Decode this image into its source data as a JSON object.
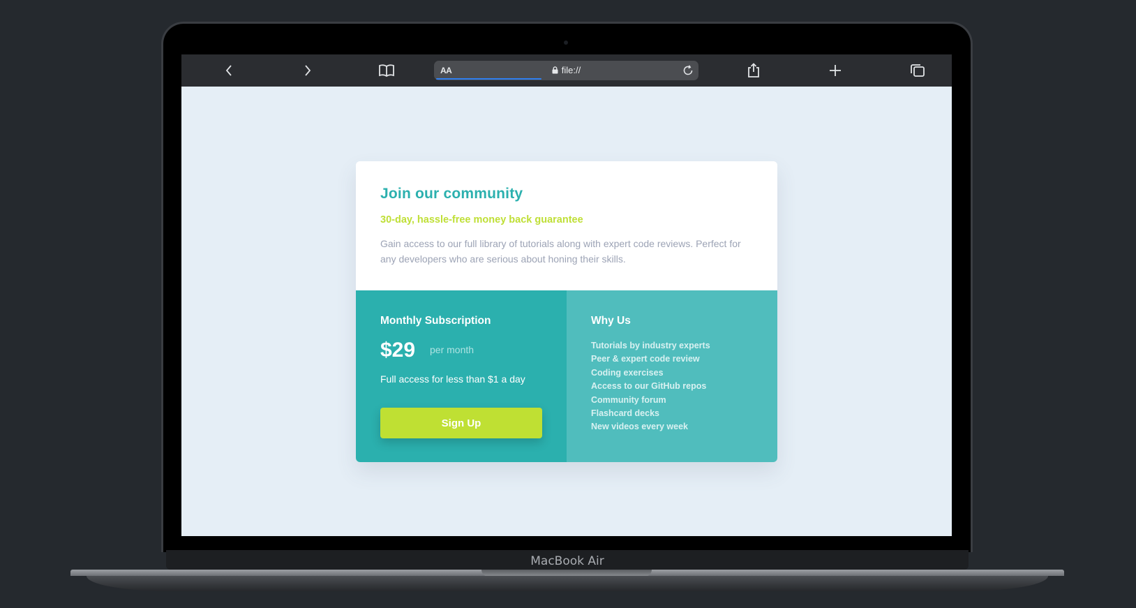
{
  "device": {
    "brand_label": "MacBook Air"
  },
  "browser": {
    "url": "file://",
    "reader_label": "AA",
    "icons": {
      "back": "chevron-left-icon",
      "forward": "chevron-right-icon",
      "bookmarks": "book-icon",
      "lock": "lock-icon",
      "reload": "reload-icon",
      "share": "share-icon",
      "new_tab": "plus-icon",
      "tabs": "tabs-icon"
    }
  },
  "card": {
    "title": "Join our community",
    "subtitle": "30-day, hassle-free money back guarantee",
    "description": "Gain access to our full library of tutorials along with expert code reviews. Perfect for any developers who are serious about honing their skills.",
    "subscription": {
      "title": "Monthly Subscription",
      "price": "$29",
      "period": "per month",
      "note": "Full access for less than $1 a day",
      "button_label": "Sign Up"
    },
    "why": {
      "title": "Why Us",
      "items": [
        "Tutorials by industry experts",
        "Peer & expert code review",
        "Coding exercises",
        "Access to our GitHub repos",
        "Community forum",
        "Flashcard decks",
        "New videos every week"
      ]
    }
  },
  "colors": {
    "primary": "#2bb0ae",
    "secondary": "#50bdbd",
    "accent": "#bfe033",
    "background": "#e5eef6"
  }
}
